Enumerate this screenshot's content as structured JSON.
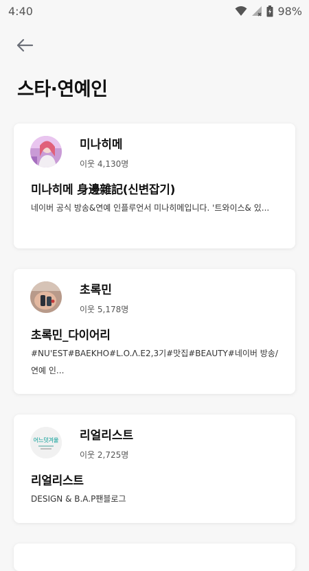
{
  "status_bar": {
    "time": "4:40",
    "battery": "98%"
  },
  "header": {
    "title": "스타·연예인"
  },
  "cards": [
    {
      "name": "미나히메",
      "neighbors": "이웃 4,130명",
      "blog_title": "미나히메 身邊雜記(신변잡기)",
      "description": "네이버 공식 방송&연예 인플루언서 미나히메입니다. '트와이스& 있..."
    },
    {
      "name": "초록민",
      "neighbors": "이웃 5,178명",
      "blog_title": "초록민_다이어리",
      "description": "#NU'EST#BAEKHO#L.O.Λ.E2,3기#맛집#BEAUTY#네이버 방송/연예 인..."
    },
    {
      "name": "리얼리스트",
      "neighbors": "이웃 2,725명",
      "blog_title": "리얼리스트",
      "description": "DESIGN & B.A.P팬블로그",
      "avatar_text": "어느덧겨울"
    }
  ]
}
